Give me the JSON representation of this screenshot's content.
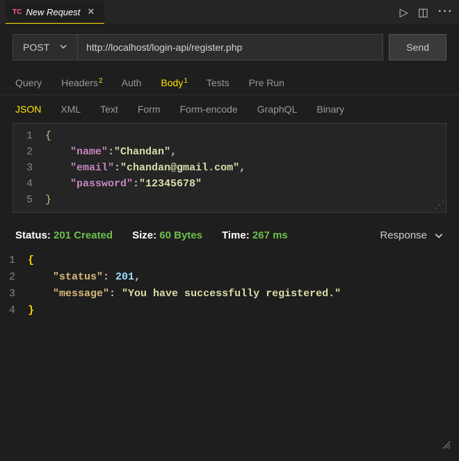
{
  "tab": {
    "prefix": "TC",
    "title": "New Request"
  },
  "titlebar_icons": {
    "run": "▷",
    "split": "◫",
    "more": "···"
  },
  "request": {
    "method": "POST",
    "url": "http://localhost/login-api/register.php",
    "send": "Send"
  },
  "req_tabs": {
    "query": "Query",
    "headers": "Headers",
    "headers_badge": "2",
    "auth": "Auth",
    "body": "Body",
    "body_badge": "1",
    "tests": "Tests",
    "prerun": "Pre Run"
  },
  "body_formats": {
    "json": "JSON",
    "xml": "XML",
    "text": "Text",
    "form": "Form",
    "formenc": "Form-encode",
    "graphql": "GraphQL",
    "binary": "Binary"
  },
  "body_lines": {
    "l1": "{",
    "l2_k": "\"name\"",
    "l2_v": "\"Chandan\"",
    "l3_k": "\"email\"",
    "l3_v": "\"chandan@gmail.com\"",
    "l4_k": "\"password\"",
    "l4_v": "\"12345678\"",
    "l5": "}"
  },
  "status": {
    "label": "Status:",
    "value": "201 Created",
    "size_label": "Size:",
    "size_value": "60 Bytes",
    "time_label": "Time:",
    "time_value": "267 ms",
    "response": "Response"
  },
  "response_lines": {
    "l1": "{",
    "l2_k": "\"status\"",
    "l2_v": "201",
    "l3_k": "\"message\"",
    "l3_v": "\"You have successfully registered.\"",
    "l4": "}"
  }
}
